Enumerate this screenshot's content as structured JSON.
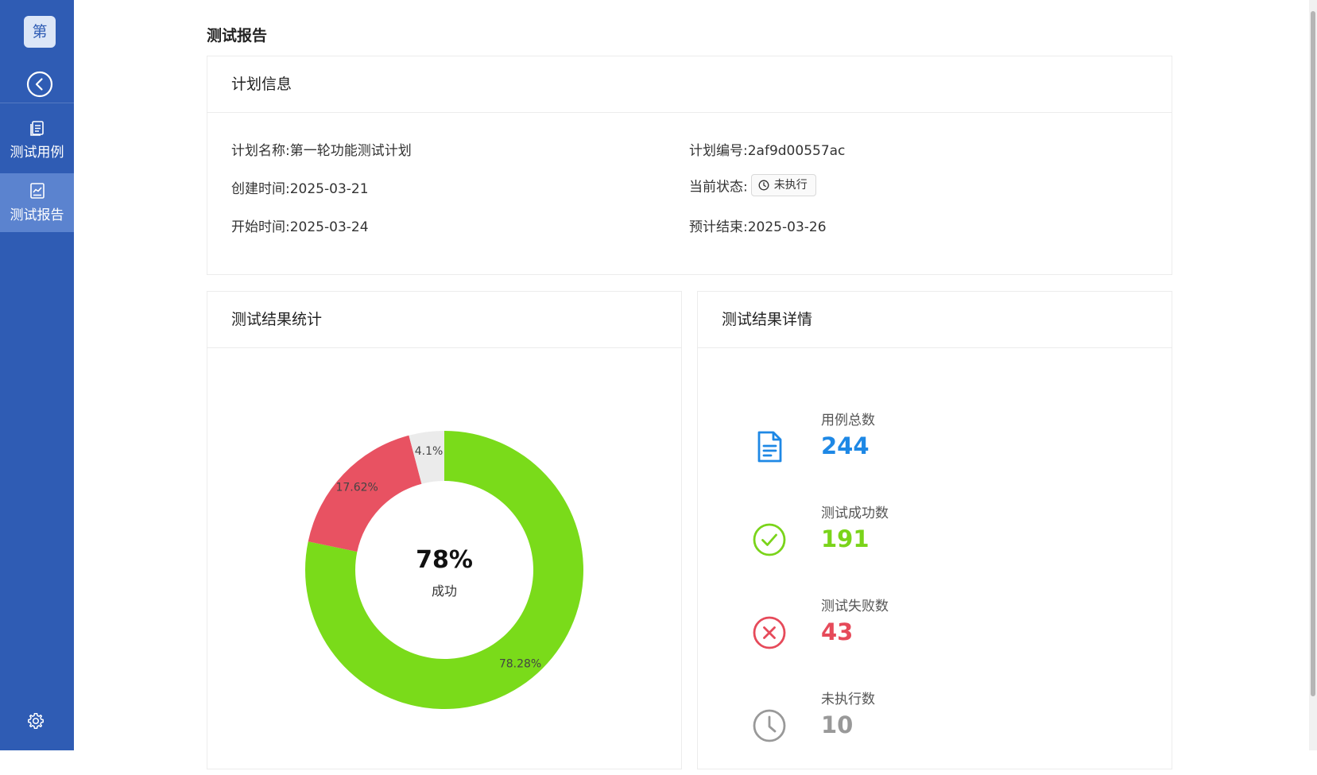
{
  "sidebar": {
    "logo_text": "第",
    "items": [
      {
        "label": "测试用例",
        "icon": "document-list-icon"
      },
      {
        "label": "测试报告",
        "icon": "report-chart-icon"
      }
    ],
    "accent": "#2f5cb4",
    "active_bg": "#5b83cf"
  },
  "page": {
    "title": "测试报告"
  },
  "plan_info": {
    "header": "计划信息",
    "name_label": "计划名称:",
    "name_value": "第一轮功能测试计划",
    "id_label": "计划编号:",
    "id_value": "2af9d00557ac",
    "created_label": "创建时间:",
    "created_value": "2025-03-21",
    "status_label": "当前状态:",
    "status_value": "未执行",
    "start_label": "开始时间:",
    "start_value": "2025-03-24",
    "end_label": "预计结束:",
    "end_value": "2025-03-26"
  },
  "stats_card": {
    "header": "测试结果统计",
    "center_pct": "78%",
    "center_label": "成功"
  },
  "chart_data": {
    "type": "pie",
    "donut": true,
    "slices": [
      {
        "label": "78.28%",
        "value": 78.28,
        "color": "#7adb1a"
      },
      {
        "label": "17.62%",
        "value": 17.62,
        "color": "#e85262"
      },
      {
        "label": "4.1%",
        "value": 4.1,
        "color": "#ebebeb"
      }
    ]
  },
  "details_card": {
    "header": "测试结果详情",
    "stats": [
      {
        "label": "用例总数",
        "value": "244",
        "color": "#1e88e5",
        "icon": "document-icon"
      },
      {
        "label": "测试成功数",
        "value": "191",
        "color": "#7ad41a",
        "icon": "check-circle-icon"
      },
      {
        "label": "测试失败数",
        "value": "43",
        "color": "#e64a5a",
        "icon": "close-circle-icon"
      },
      {
        "label": "未执行数",
        "value": "10",
        "color": "#999999",
        "icon": "clock-icon"
      }
    ]
  }
}
